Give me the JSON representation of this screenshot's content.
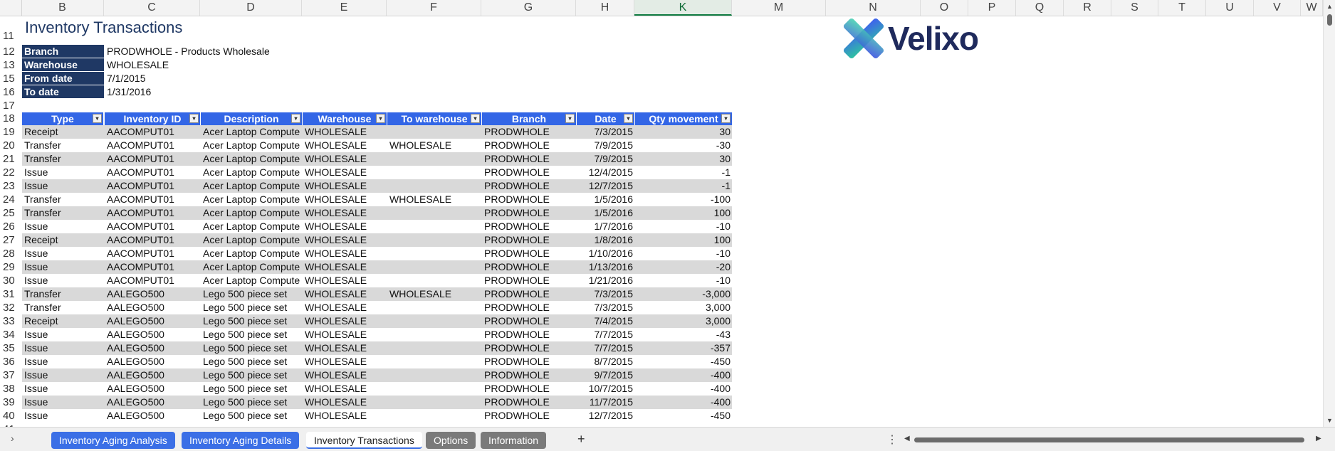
{
  "columns": [
    "B",
    "C",
    "D",
    "E",
    "F",
    "G",
    "H",
    "K",
    "M",
    "N",
    "O",
    "P",
    "Q",
    "R",
    "S",
    "T",
    "U",
    "V",
    "W"
  ],
  "selected_column": "K",
  "report": {
    "title": "Inventory Transactions",
    "params": [
      {
        "label": "Branch",
        "value": "PRODWHOLE - Products Wholesale"
      },
      {
        "label": "Warehouse",
        "value": "WHOLESALE"
      },
      {
        "label": "From date",
        "value": "7/1/2015"
      },
      {
        "label": "To date",
        "value": "1/31/2016"
      }
    ]
  },
  "logo": {
    "text": "Velixo",
    "icon": "velixo-x-logo-icon"
  },
  "table": {
    "headers": [
      "Type",
      "Inventory ID",
      "Description",
      "Warehouse",
      "To warehouse",
      "Branch",
      "Date",
      "Qty movement"
    ],
    "rows": [
      [
        "Receipt",
        "AACOMPUT01",
        "Acer Laptop Compute",
        "WHOLESALE",
        "",
        "PRODWHOLE",
        "7/3/2015",
        "30"
      ],
      [
        "Transfer",
        "AACOMPUT01",
        "Acer Laptop Compute",
        "WHOLESALE",
        "WHOLESALE",
        "PRODWHOLE",
        "7/9/2015",
        "-30"
      ],
      [
        "Transfer",
        "AACOMPUT01",
        "Acer Laptop Compute",
        "WHOLESALE",
        "",
        "PRODWHOLE",
        "7/9/2015",
        "30"
      ],
      [
        "Issue",
        "AACOMPUT01",
        "Acer Laptop Compute",
        "WHOLESALE",
        "",
        "PRODWHOLE",
        "12/4/2015",
        "-1"
      ],
      [
        "Issue",
        "AACOMPUT01",
        "Acer Laptop Compute",
        "WHOLESALE",
        "",
        "PRODWHOLE",
        "12/7/2015",
        "-1"
      ],
      [
        "Transfer",
        "AACOMPUT01",
        "Acer Laptop Compute",
        "WHOLESALE",
        "WHOLESALE",
        "PRODWHOLE",
        "1/5/2016",
        "-100"
      ],
      [
        "Transfer",
        "AACOMPUT01",
        "Acer Laptop Compute",
        "WHOLESALE",
        "",
        "PRODWHOLE",
        "1/5/2016",
        "100"
      ],
      [
        "Issue",
        "AACOMPUT01",
        "Acer Laptop Compute",
        "WHOLESALE",
        "",
        "PRODWHOLE",
        "1/7/2016",
        "-10"
      ],
      [
        "Receipt",
        "AACOMPUT01",
        "Acer Laptop Compute",
        "WHOLESALE",
        "",
        "PRODWHOLE",
        "1/8/2016",
        "100"
      ],
      [
        "Issue",
        "AACOMPUT01",
        "Acer Laptop Compute",
        "WHOLESALE",
        "",
        "PRODWHOLE",
        "1/10/2016",
        "-10"
      ],
      [
        "Issue",
        "AACOMPUT01",
        "Acer Laptop Compute",
        "WHOLESALE",
        "",
        "PRODWHOLE",
        "1/13/2016",
        "-20"
      ],
      [
        "Issue",
        "AACOMPUT01",
        "Acer Laptop Compute",
        "WHOLESALE",
        "",
        "PRODWHOLE",
        "1/21/2016",
        "-10"
      ],
      [
        "Transfer",
        "AALEGO500",
        "Lego 500 piece set",
        "WHOLESALE",
        "WHOLESALE",
        "PRODWHOLE",
        "7/3/2015",
        "-3,000"
      ],
      [
        "Transfer",
        "AALEGO500",
        "Lego 500 piece set",
        "WHOLESALE",
        "",
        "PRODWHOLE",
        "7/3/2015",
        "3,000"
      ],
      [
        "Receipt",
        "AALEGO500",
        "Lego 500 piece set",
        "WHOLESALE",
        "",
        "PRODWHOLE",
        "7/4/2015",
        "3,000"
      ],
      [
        "Issue",
        "AALEGO500",
        "Lego 500 piece set",
        "WHOLESALE",
        "",
        "PRODWHOLE",
        "7/7/2015",
        "-43"
      ],
      [
        "Issue",
        "AALEGO500",
        "Lego 500 piece set",
        "WHOLESALE",
        "",
        "PRODWHOLE",
        "7/7/2015",
        "-357"
      ],
      [
        "Issue",
        "AALEGO500",
        "Lego 500 piece set",
        "WHOLESALE",
        "",
        "PRODWHOLE",
        "8/7/2015",
        "-450"
      ],
      [
        "Issue",
        "AALEGO500",
        "Lego 500 piece set",
        "WHOLESALE",
        "",
        "PRODWHOLE",
        "9/7/2015",
        "-400"
      ],
      [
        "Issue",
        "AALEGO500",
        "Lego 500 piece set",
        "WHOLESALE",
        "",
        "PRODWHOLE",
        "10/7/2015",
        "-400"
      ],
      [
        "Issue",
        "AALEGO500",
        "Lego 500 piece set",
        "WHOLESALE",
        "",
        "PRODWHOLE",
        "11/7/2015",
        "-400"
      ],
      [
        "Issue",
        "AALEGO500",
        "Lego 500 piece set",
        "WHOLESALE",
        "",
        "PRODWHOLE",
        "12/7/2015",
        "-450"
      ]
    ]
  },
  "row_numbers": {
    "title": "11",
    "params": [
      "12",
      "13",
      "15",
      "16"
    ],
    "blank": "17",
    "header": "18",
    "data": [
      "19",
      "20",
      "21",
      "22",
      "23",
      "24",
      "25",
      "26",
      "27",
      "28",
      "29",
      "30",
      "31",
      "32",
      "33",
      "34",
      "35",
      "36",
      "37",
      "38",
      "39",
      "40"
    ],
    "partial": "41"
  },
  "sheet_tabs": [
    {
      "label": "Inventory Aging Analysis",
      "style": "blue"
    },
    {
      "label": "Inventory Aging Details",
      "style": "blue"
    },
    {
      "label": "Inventory Transactions",
      "style": "active"
    },
    {
      "label": "Options",
      "style": "gray"
    },
    {
      "label": "Information",
      "style": "gray"
    }
  ],
  "colors": {
    "header_blue": "#3366e6",
    "param_navy": "#1f3864",
    "band_gray": "#d9d9d9",
    "excel_green": "#107c41"
  }
}
